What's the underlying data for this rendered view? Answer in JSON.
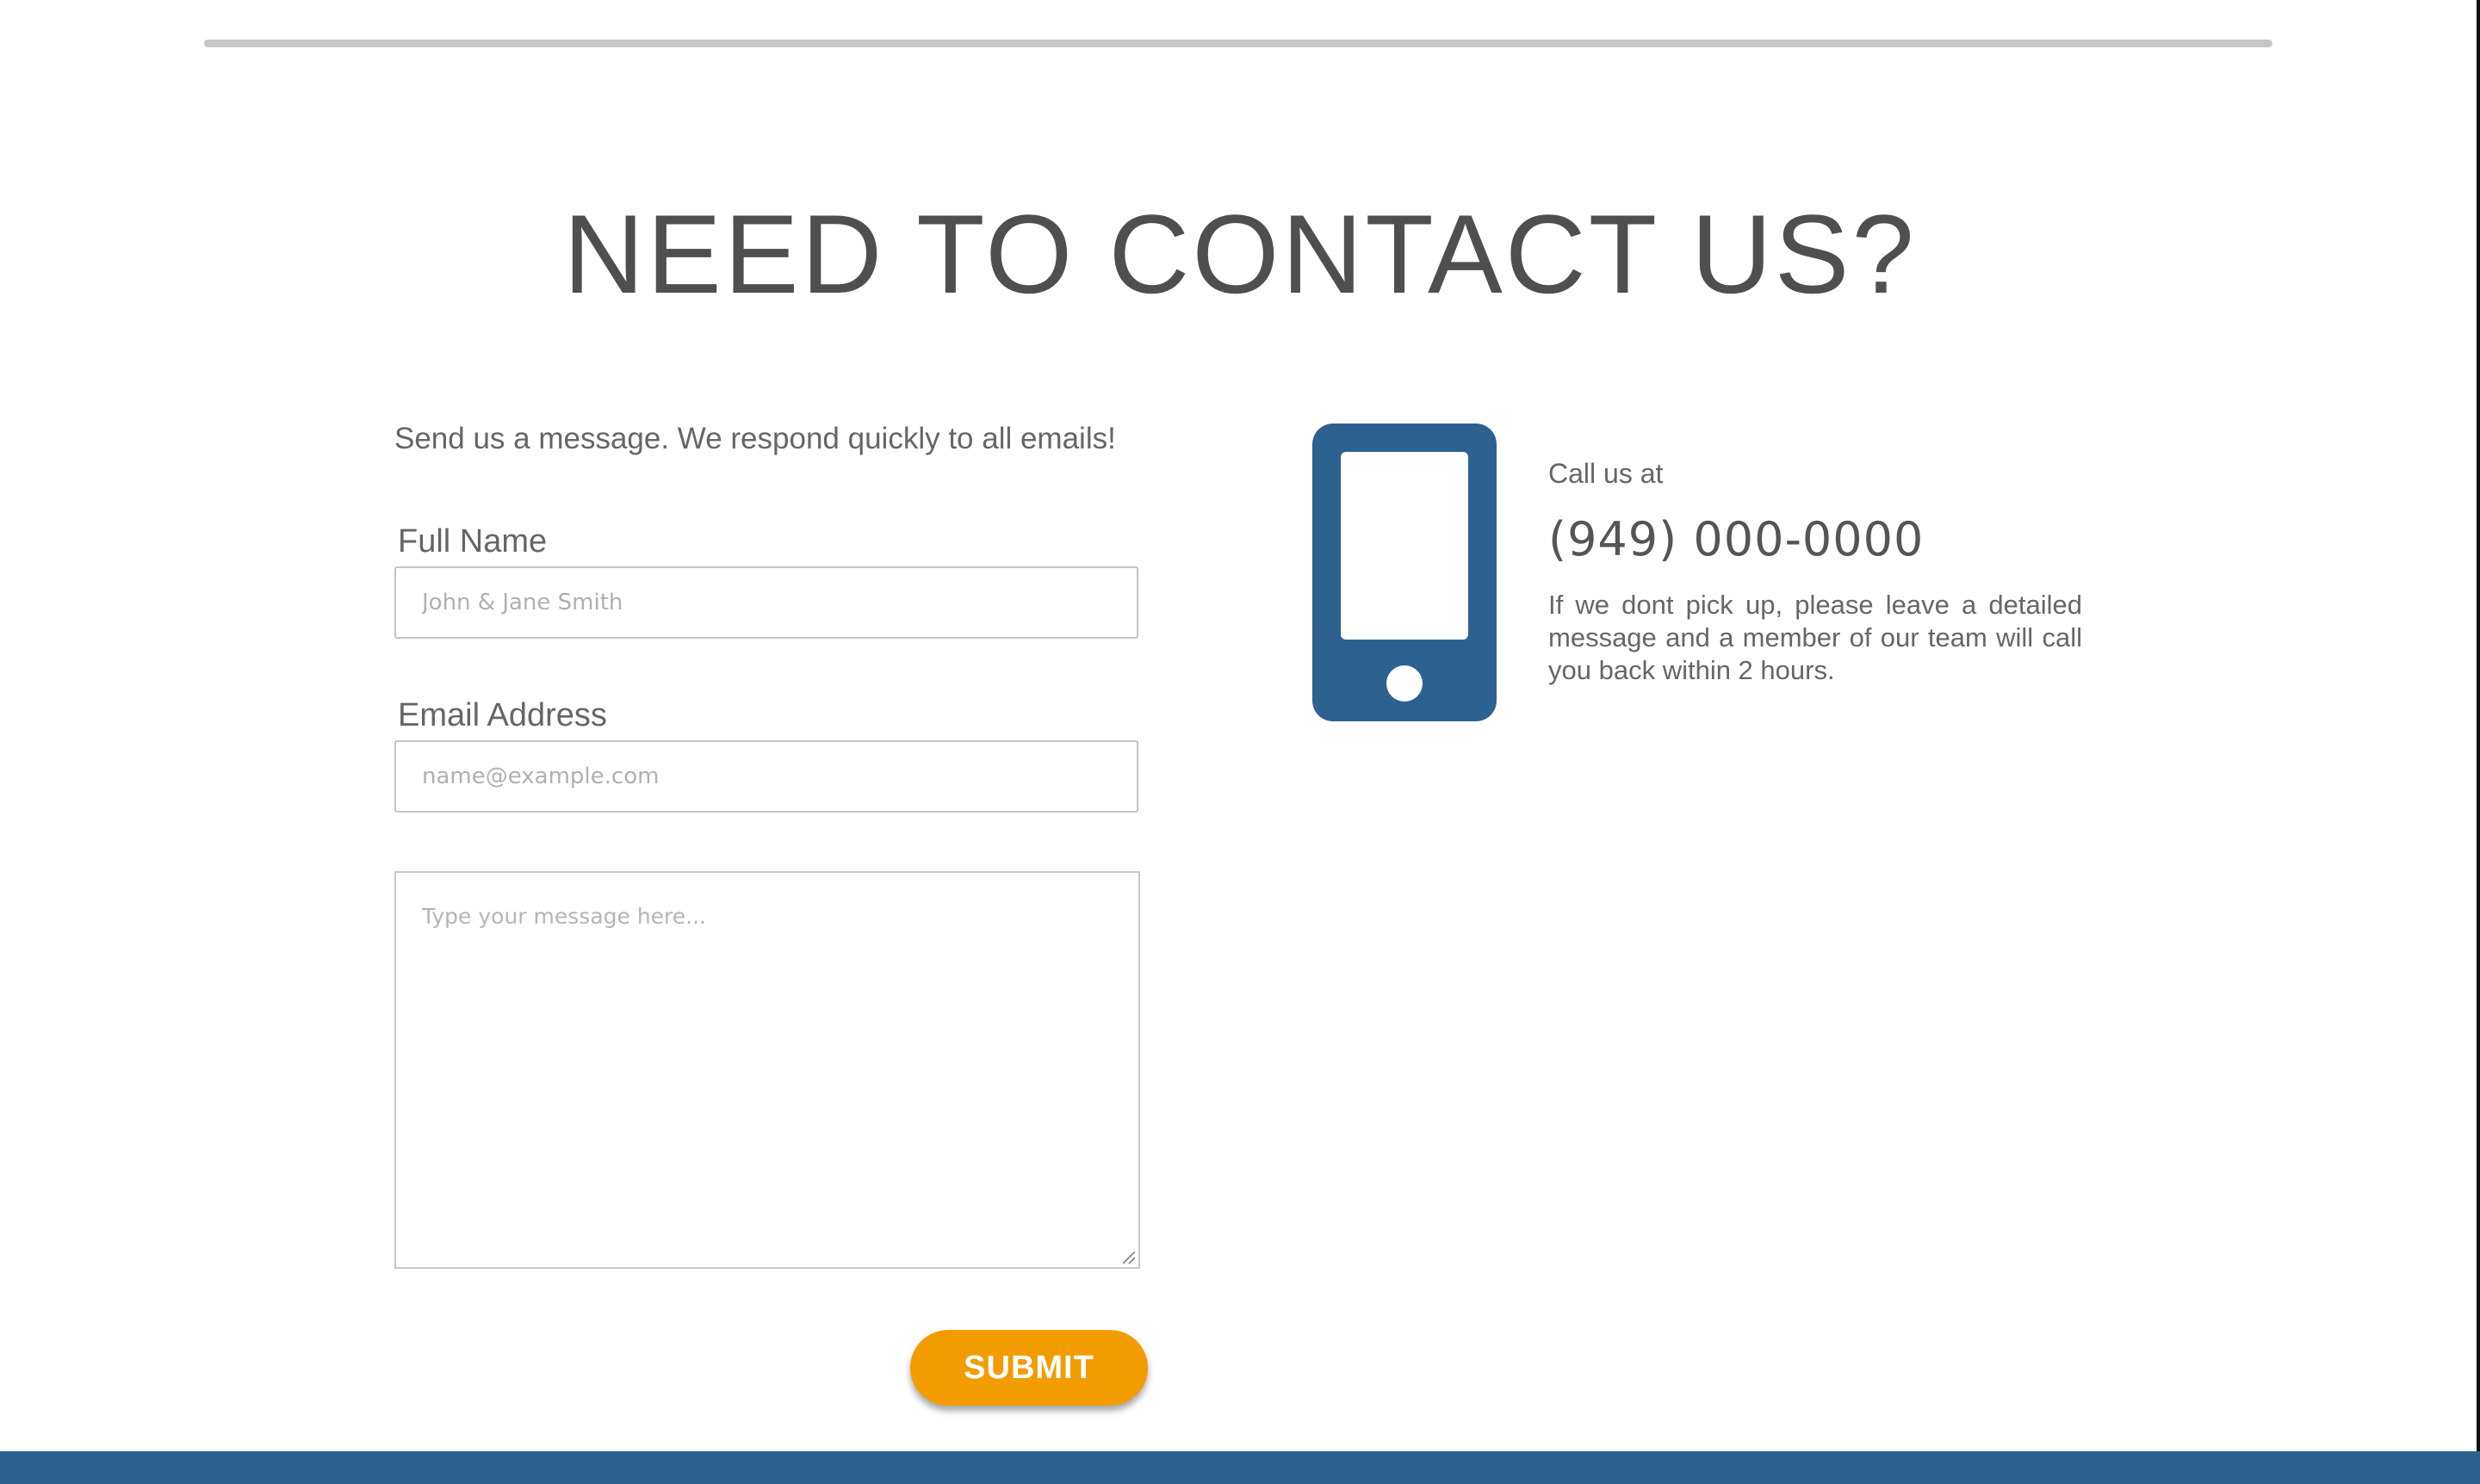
{
  "heading": "NEED TO CONTACT US?",
  "form": {
    "intro": "Send us a message. We respond quickly to all emails!",
    "name_label": "Full Name",
    "name_placeholder": "John & Jane Smith",
    "email_label": "Email Address",
    "email_placeholder": "name@example.com",
    "message_placeholder": "Type your message here...",
    "submit_label": "SUBMIT"
  },
  "contact": {
    "icon": "smartphone-icon",
    "call_label": "Call us at",
    "phone": "(949) 000-0000",
    "note": "If we dont pick up, please leave a detailed message and a member of our team will call you back within 2 hours."
  },
  "colors": {
    "accent": "#f39c00",
    "brand_blue": "#2d6190",
    "heading_text": "#4f4f4f"
  }
}
